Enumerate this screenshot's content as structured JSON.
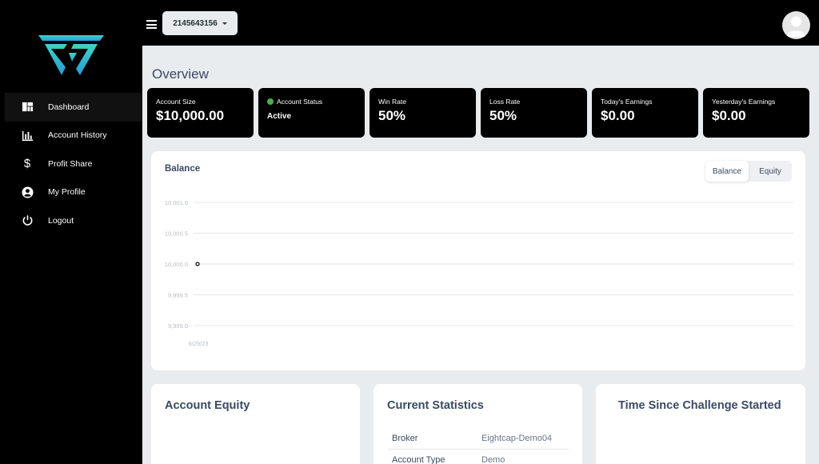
{
  "brand": {
    "logo_colors": [
      "#3fd3c4",
      "#2a9bd6"
    ]
  },
  "sidebar": {
    "items": [
      {
        "label": "Dashboard",
        "icon": "dashboard-icon",
        "active": true
      },
      {
        "label": "Account History",
        "icon": "bar-chart-icon",
        "active": false
      },
      {
        "label": "Profit Share",
        "icon": "dollar-icon",
        "active": false
      },
      {
        "label": "My Profile",
        "icon": "user-circle-icon",
        "active": false
      },
      {
        "label": "Logout",
        "icon": "power-icon",
        "active": false
      }
    ]
  },
  "topbar": {
    "account_number": "2145643156"
  },
  "main": {
    "title": "Overview",
    "stats": [
      {
        "label": "Account Size",
        "value": "$10,000.00"
      },
      {
        "label": "Account Status",
        "value": "Active",
        "status_color": "#4caf50"
      },
      {
        "label": "Win Rate",
        "value": "50%"
      },
      {
        "label": "Loss Rate",
        "value": "50%"
      },
      {
        "label": "Today's Earnings",
        "value": "$0.00"
      },
      {
        "label": "Yesterday's Earnings",
        "value": "$0.00"
      }
    ],
    "balance_panel": {
      "title": "Balance",
      "toggle": {
        "options": [
          "Balance",
          "Equity"
        ],
        "selected": "Balance"
      }
    },
    "bottom_cards": [
      {
        "title": "Account Equity"
      },
      {
        "title": "Current Statistics",
        "rows": [
          {
            "key": "Broker",
            "value": "Eightcap-Demo04"
          },
          {
            "key": "Account Type",
            "value": "Demo"
          }
        ]
      },
      {
        "title": "Time Since Challenge Started"
      }
    ]
  },
  "chart_data": {
    "type": "line",
    "title": "",
    "xlabel": "",
    "ylabel": "",
    "y_ticks": [
      "10,001.0",
      "10,000.5",
      "10,000.0",
      "9,999.5",
      "9,999.0"
    ],
    "ylim": [
      9999.0,
      10001.0
    ],
    "x_ticks": [
      "6/29/23"
    ],
    "series": [
      {
        "x": [
          "6/29/23"
        ],
        "y": [
          10000.0
        ]
      }
    ],
    "grid": true,
    "legend": "none"
  }
}
